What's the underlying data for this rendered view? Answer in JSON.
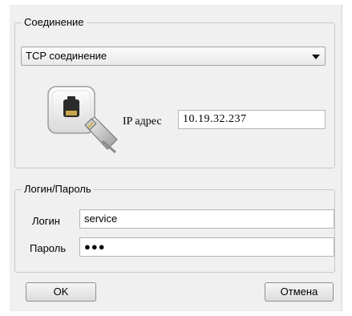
{
  "connection": {
    "group_title": "Соединение",
    "type_select": {
      "selected": "TCP соединение"
    },
    "ip_label": "IP адрес",
    "ip_value": "10.19.32.237",
    "icon": "network-plug-icon"
  },
  "credentials": {
    "group_title": "Логин/Пароль",
    "login_label": "Логин",
    "login_value": "service",
    "password_label": "Пароль",
    "password_value": "●●●"
  },
  "buttons": {
    "ok_label": "OK",
    "cancel_label": "Отмена"
  }
}
